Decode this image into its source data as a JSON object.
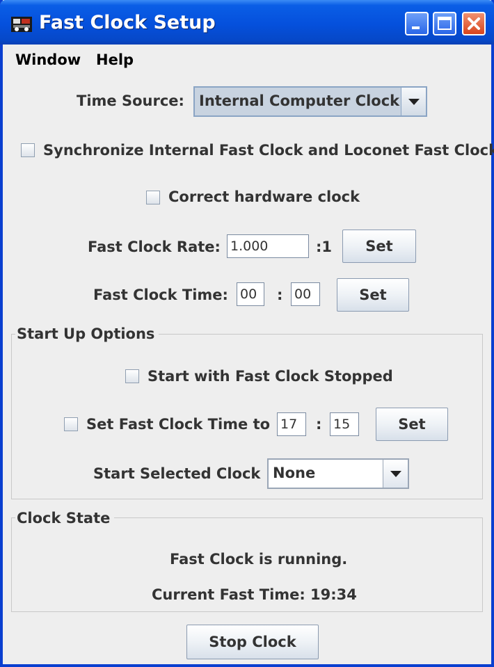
{
  "window": {
    "title": "Fast Clock Setup"
  },
  "menu": {
    "items": [
      "Window",
      "Help"
    ]
  },
  "time_source": {
    "label": "Time Source:",
    "value": "Internal Computer Clock"
  },
  "sync": {
    "label": "Synchronize Internal Fast Clock and  Loconet Fast Clock",
    "checked": false
  },
  "correct_hw": {
    "label": "Correct hardware clock",
    "checked": false
  },
  "rate": {
    "label": "Fast Clock Rate:",
    "value": "1.000",
    "suffix": ":1",
    "set_label": "Set"
  },
  "time": {
    "label": "Fast Clock Time:",
    "hours": "00",
    "sep": ":",
    "minutes": "00",
    "set_label": "Set"
  },
  "startup": {
    "title": "Start Up Options",
    "stopped": {
      "label": "Start with Fast Clock Stopped",
      "checked": false
    },
    "set_time": {
      "label": "Set Fast Clock Time to",
      "hours": "17",
      "sep": ":",
      "minutes": "15",
      "set_label": "Set",
      "checked": false
    },
    "selected_clock": {
      "label": "Start Selected Clock",
      "value": "None"
    }
  },
  "clock_state": {
    "title": "Clock State",
    "status": "Fast Clock is running.",
    "current_label": "Current Fast Time:",
    "current_value": "19:34"
  },
  "stop_button": "Stop Clock",
  "colors": {
    "titlebar": "#0550dc",
    "window_border": "#0a3fd0",
    "close": "#d8441c"
  }
}
